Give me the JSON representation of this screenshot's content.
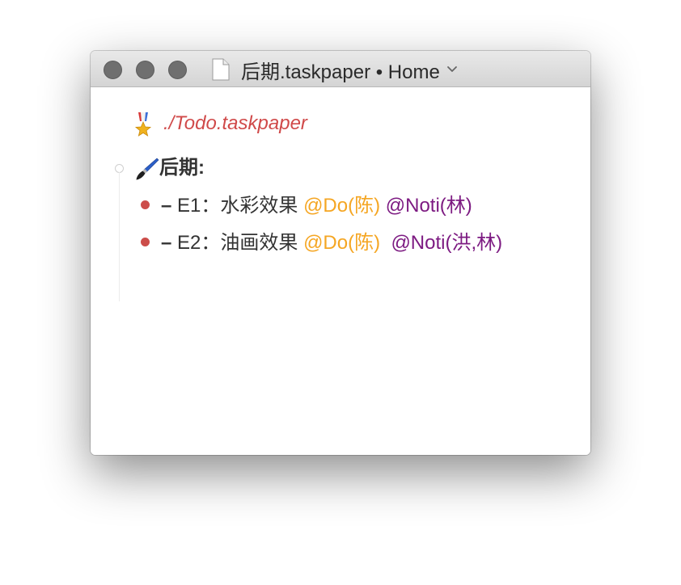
{
  "window": {
    "title": "后期.taskpaper • Home"
  },
  "document": {
    "link_text": "./Todo.taskpaper",
    "project": {
      "title": "后期:"
    },
    "tasks": [
      {
        "dash": "–",
        "text": " E1：水彩效果 ",
        "tag_do": "@Do(陈)",
        "spacer": " ",
        "tag_noti": "@Noti(林)"
      },
      {
        "dash": "–",
        "text": " E2：油画效果 ",
        "tag_do": "@Do(陈)",
        "spacer": "  ",
        "tag_noti": "@Noti(洪,林)"
      }
    ]
  },
  "colors": {
    "bullet": "#cc4d4a",
    "link": "#d04a4a",
    "tag_do": "#f5a623",
    "tag_noti": "#7d1b82"
  },
  "icons": [
    "document-icon",
    "chevron-down-icon",
    "medal-icon",
    "paintbrush-icon"
  ]
}
